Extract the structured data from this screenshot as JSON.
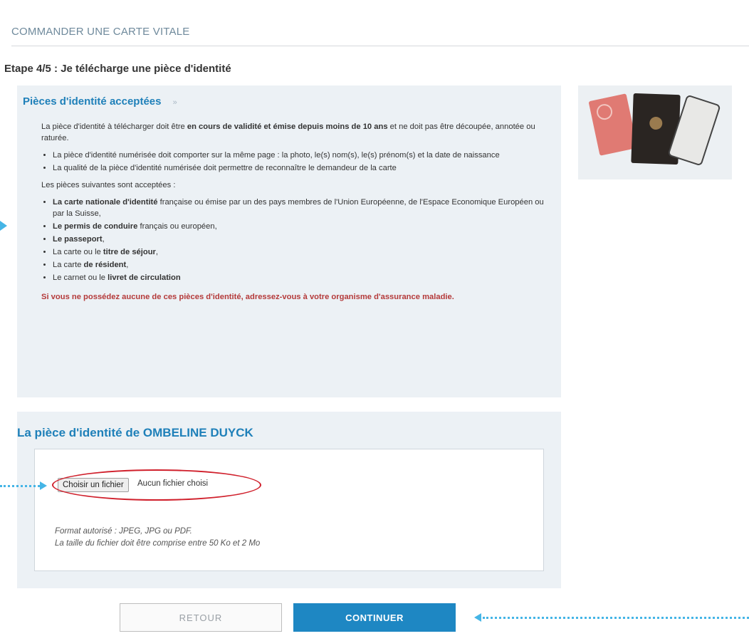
{
  "header": {
    "page_title": "COMMANDER UNE CARTE VITALE",
    "step_title": "Etape 4/5 : Je télécharge une pièce d'identité"
  },
  "id_panel": {
    "title": "Pièces d'identité acceptées",
    "toggle_icon": "»",
    "intro_prefix": "La pièce d'identité à télécharger doit être ",
    "intro_bold": "en cours de validité et émise depuis moins de 10 ans",
    "intro_suffix": " et ne doit pas être découpée, annotée ou raturée.",
    "rules": [
      "La pièce d'identité numérisée doit comporter sur la même page : la photo, le(s) nom(s), le(s) prénom(s) et la date de naissance",
      "La qualité de la pièce d'identité numérisée doit permettre de reconnaître le demandeur de la carte"
    ],
    "accepted_intro": "Les pièces suivantes sont acceptées :",
    "accepted": [
      {
        "bold": "La carte nationale d'identité",
        "rest": " française ou émise par un des pays membres de l'Union Européenne, de l'Espace Economique Européen ou par la Suisse,"
      },
      {
        "bold": "Le permis de conduire",
        "rest": " français ou européen,"
      },
      {
        "bold": "Le passeport",
        "rest": ","
      },
      {
        "pre": "La carte ou le ",
        "bold": "titre de séjour",
        "rest": ","
      },
      {
        "pre": "La carte ",
        "bold": "de résident",
        "rest": ","
      },
      {
        "pre": "Le carnet ou le ",
        "bold": "livret de circulation",
        "rest": ""
      }
    ],
    "warning": "Si vous ne possédez aucune de ces pièces d'identité, adressez-vous à votre organisme d'assurance maladie."
  },
  "upload": {
    "title": "La pièce d'identité de OMBELINE DUYCK",
    "choose_button": "Choisir un fichier",
    "file_status": "Aucun fichier choisi",
    "hint_format": "Format autorisé : JPEG, JPG ou PDF.",
    "hint_size": "La taille du fichier doit être comprise entre 50 Ko et 2 Mo"
  },
  "buttons": {
    "back": "RETOUR",
    "continue": "CONTINUER"
  },
  "colors": {
    "accent_blue": "#1e87c3",
    "panel_bg": "#ecf1f5",
    "warning_red": "#b43a3a",
    "annotation_cyan": "#45b5e6",
    "highlight_red": "#d0202c"
  }
}
